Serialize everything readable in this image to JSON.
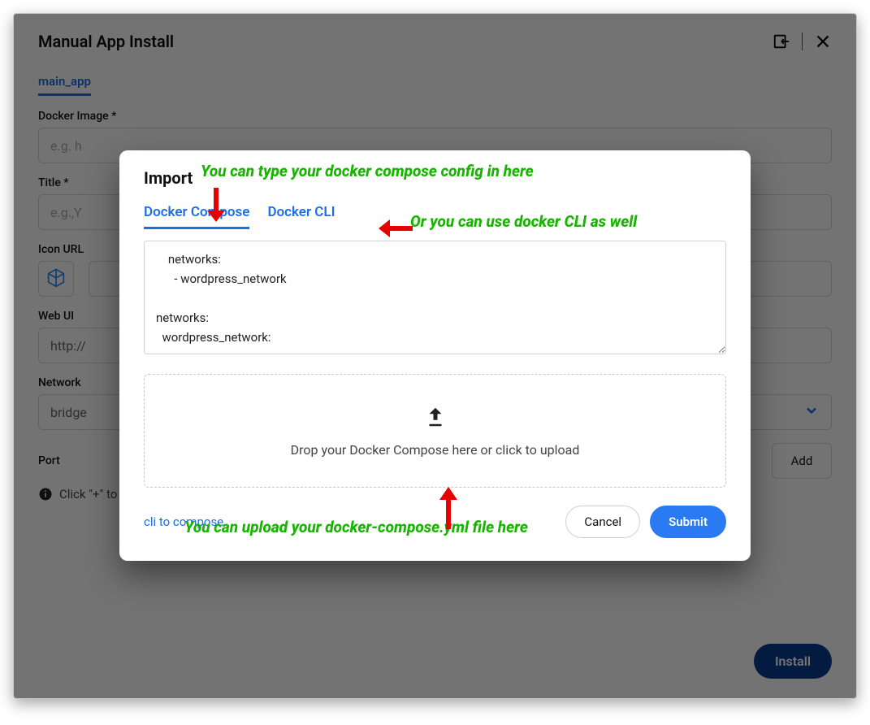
{
  "header": {
    "title": "Manual App Install"
  },
  "subtabs": {
    "active": "main_app"
  },
  "fields": {
    "docker_image": {
      "label": "Docker Image *",
      "placeholder": "e.g. h"
    },
    "title": {
      "label": "Title *",
      "placeholder": "e.g.,Y"
    },
    "icon_url": {
      "label": "Icon URL"
    },
    "web_ui": {
      "label": "Web UI",
      "value": "http://"
    },
    "network": {
      "label": "Network",
      "value": "bridge"
    },
    "port": {
      "label": "Port",
      "add_label": "Add",
      "hint": "Click \"+\" to add one."
    }
  },
  "install_label": "Install",
  "import": {
    "title": "Import",
    "tabs": {
      "compose": "Docker Compose",
      "cli": "Docker CLI"
    },
    "textarea": "    networks:\n      - wordpress_network\n\nnetworks:\n  wordpress_network:",
    "drop_text": "Drop your Docker Compose here or click to upload",
    "cli_link": "cli to compose",
    "cancel": "Cancel",
    "submit": "Submit"
  },
  "annotations": {
    "a1": "You can type your docker compose config in here",
    "a2": "Or you can use docker CLI as well",
    "a3": "You can upload your docker-compose.yml file here"
  }
}
